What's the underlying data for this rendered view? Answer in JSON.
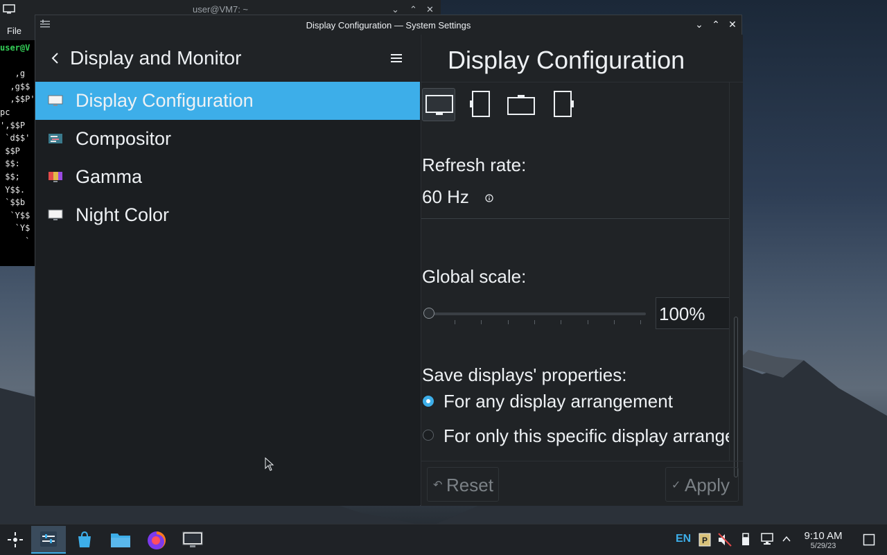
{
  "terminal": {
    "title": "user@VM7: ~",
    "menu_file": "File",
    "lines": [
      "user@V",
      "",
      "   ,g",
      "  ,g$$",
      "  ,$$P'",
      "pc",
      "',$$P",
      " `d$$'",
      " $$P",
      " $$:",
      " $$;",
      " Y$$.",
      " `$$b",
      "  `Y$$",
      "   `Y$",
      "     `"
    ]
  },
  "window": {
    "title": "Display Configuration — System Settings"
  },
  "sidebar": {
    "header": "Display and Monitor",
    "items": [
      {
        "label": "Display Configuration"
      },
      {
        "label": "Compositor"
      },
      {
        "label": "Gamma"
      },
      {
        "label": "Night Color"
      }
    ]
  },
  "page": {
    "title": "Display Configuration",
    "refresh_label": "Refresh rate:",
    "refresh_value": "60 Hz",
    "scale_label": "Global scale:",
    "scale_value": "100%",
    "scale_fraction": 0.0,
    "save_label": "Save displays' properties:",
    "options": [
      {
        "label": "For any display arrangement",
        "selected": true
      },
      {
        "label": "For only this specific display arrangement",
        "selected": false
      }
    ],
    "reset_label": "Reset",
    "apply_label": "Apply"
  },
  "taskbar": {
    "lang": "EN",
    "time": "9:10 AM",
    "date": "5/29/23"
  },
  "colors": {
    "accent": "#3daee9",
    "window_bg": "#1b1e21",
    "header_bg": "#202326"
  }
}
